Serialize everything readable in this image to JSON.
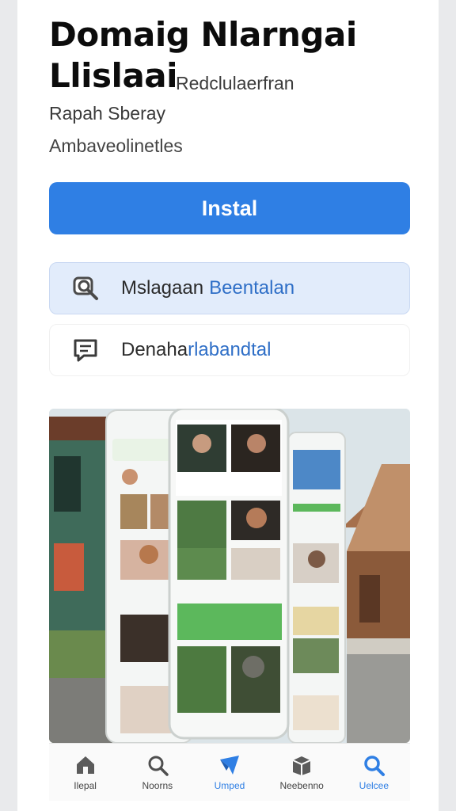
{
  "app": {
    "title_line1": "Domaig Nlarngai",
    "title_line2": "Llislaai",
    "developer": "Redclulaerfran",
    "subtitle": "Rapah Sberay",
    "category": "Ambaveolinetles"
  },
  "install_button": {
    "label": "Instal"
  },
  "actions": {
    "search": {
      "text": "Mslagaan",
      "highlight": "Beentalan"
    },
    "review": {
      "text": "Denaha",
      "highlight": "rlabandtal"
    }
  },
  "tabs": [
    {
      "label": "Ilepal",
      "icon": "home-icon"
    },
    {
      "label": "Noorns",
      "icon": "search-icon"
    },
    {
      "label": "Umped",
      "icon": "send-icon"
    },
    {
      "label": "Neebenno",
      "icon": "box-icon"
    },
    {
      "label": "Uelcee",
      "icon": "search-icon"
    }
  ],
  "colors": {
    "accent": "#2f7fe4",
    "accent_green": "#5cb85c",
    "search_bg": "#e2ecfb"
  }
}
